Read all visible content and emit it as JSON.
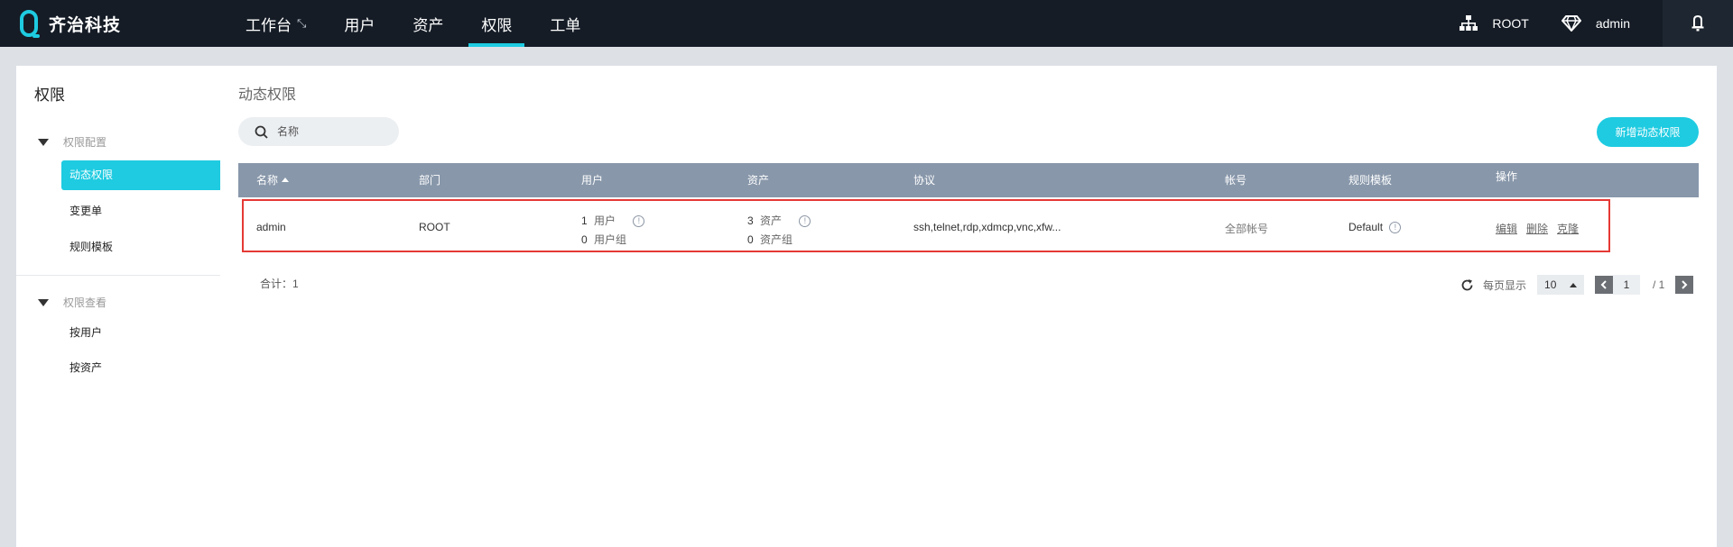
{
  "brand": {
    "name": "齐治科技"
  },
  "nav": {
    "items": [
      {
        "label": "工作台"
      },
      {
        "label": "用户"
      },
      {
        "label": "资产"
      },
      {
        "label": "权限"
      },
      {
        "label": "工单"
      }
    ],
    "active": "权限"
  },
  "top_right": {
    "org": "ROOT",
    "user": "admin"
  },
  "sidebar": {
    "title": "权限",
    "groups": [
      {
        "label": "权限配置",
        "items": [
          {
            "label": "动态权限"
          },
          {
            "label": "变更单"
          },
          {
            "label": "规则模板"
          }
        ]
      },
      {
        "label": "权限查看",
        "items": [
          {
            "label": "按用户"
          },
          {
            "label": "按资产"
          }
        ]
      }
    ],
    "active_item": "动态权限"
  },
  "main": {
    "title": "动态权限",
    "search_placeholder": "名称",
    "add_button": "新增动态权限",
    "table": {
      "headers": [
        "名称",
        "部门",
        "用户",
        "资产",
        "协议",
        "帐号",
        "规则模板",
        "操作"
      ],
      "sorted_column": "名称",
      "rows": [
        {
          "name": "admin",
          "dept": "ROOT",
          "users_line1_count": "1",
          "users_line1_label": "用户",
          "users_line2_count": "0",
          "users_line2_label": "用户组",
          "assets_line1_count": "3",
          "assets_line1_label": "资产",
          "assets_line2_count": "0",
          "assets_line2_label": "资产组",
          "protocols": "ssh,telnet,rdp,xdmcp,vnc,xfw...",
          "accounts": "全部帐号",
          "template": "Default",
          "ops": [
            "编辑",
            "删除",
            "克隆"
          ]
        }
      ]
    },
    "total": "合计：1",
    "pager": {
      "per_page_label": "每页显示",
      "page_size": "10",
      "current_page": "1",
      "total_pages": "/ 1"
    }
  },
  "colors": {
    "accent": "#1ecbe1",
    "topbar": "#151c26",
    "table_header": "#8897aa",
    "highlight_border": "#e53935"
  }
}
